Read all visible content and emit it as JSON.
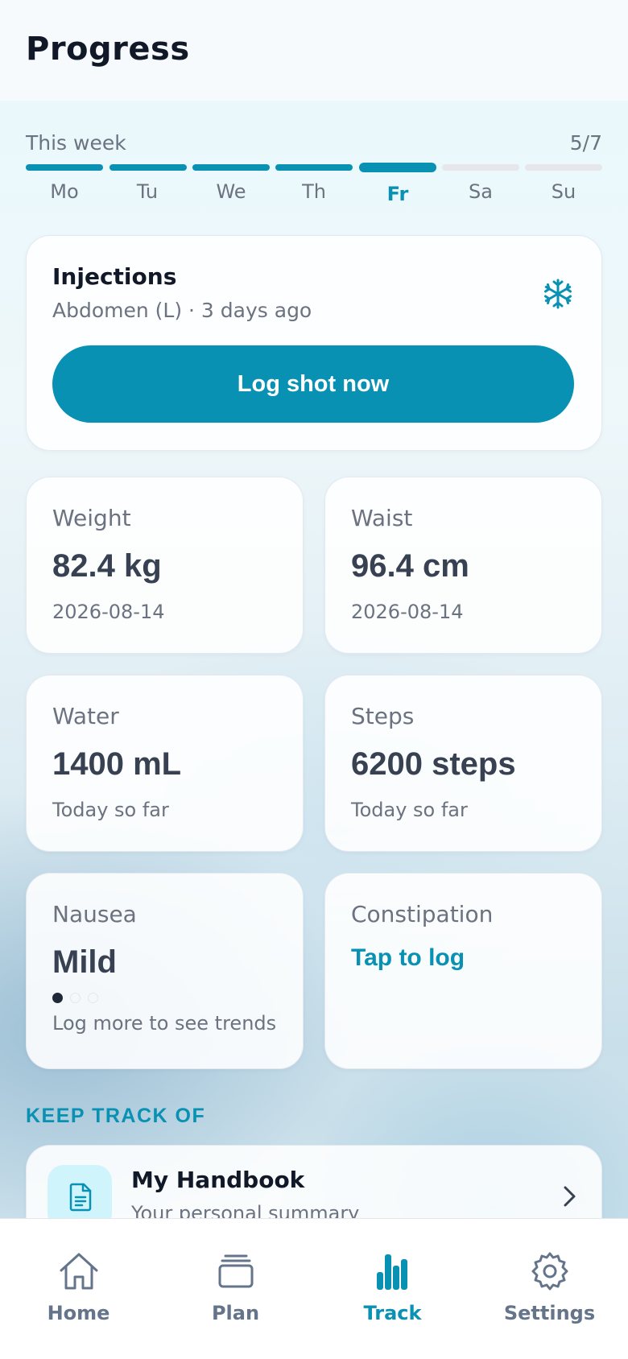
{
  "header": {
    "title": "Progress"
  },
  "week": {
    "label": "This week",
    "count": "5/7",
    "days": [
      "Mo",
      "Tu",
      "We",
      "Th",
      "Fr",
      "Sa",
      "Su"
    ],
    "completed_days": 4,
    "current_day_index": 4
  },
  "injections": {
    "title": "Injections",
    "subtitle": "Abdomen (L) · 3 days ago",
    "icon": "snowflake-icon",
    "button_label": "Log shot now"
  },
  "metrics": {
    "weight": {
      "label": "Weight",
      "value": "82.4 kg",
      "sub": "2026-08-14"
    },
    "waist": {
      "label": "Waist",
      "value": "96.4 cm",
      "sub": "2026-08-14"
    },
    "water": {
      "label": "Water",
      "value": "1400 mL",
      "sub": "Today so far"
    },
    "steps": {
      "label": "Steps",
      "value": "6200 steps",
      "sub": "Today so far"
    },
    "nausea": {
      "label": "Nausea",
      "value": "Mild",
      "sub": "Log more to see trends",
      "level": 1,
      "level_max": 3
    },
    "constipation": {
      "label": "Constipation",
      "action": "Tap to log"
    }
  },
  "keep_track": {
    "title": "KEEP TRACK OF",
    "handbook": {
      "title": "My Handbook",
      "subtitle": "Your personal summary",
      "icon": "document-icon"
    }
  },
  "tabs": [
    {
      "label": "Home",
      "icon": "home-icon",
      "active": false
    },
    {
      "label": "Plan",
      "icon": "stack-icon",
      "active": false
    },
    {
      "label": "Track",
      "icon": "bar-chart-icon",
      "active": true
    },
    {
      "label": "Settings",
      "icon": "gear-icon",
      "active": false
    }
  ],
  "colors": {
    "accent": "#0891b2",
    "text_primary": "#111827",
    "text_secondary": "#6b7280",
    "bar_inactive": "#e5e7eb"
  }
}
